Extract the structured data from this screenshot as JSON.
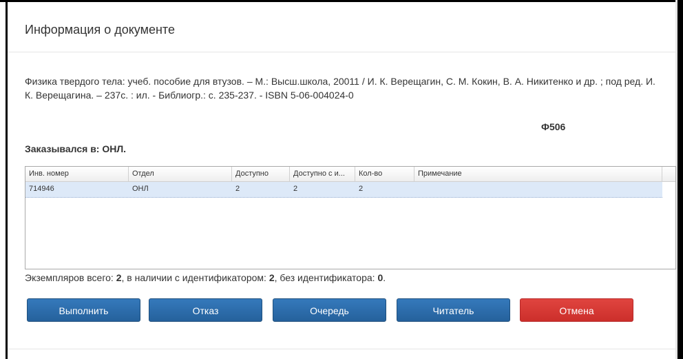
{
  "dialog": {
    "title": "Информация о документе",
    "description": "Физика твердого тела: учеб. пособие для втузов. – М.: Высш.школа, 20011 / И. К. Верещагин, С. М. Кокин, В. А. Никитенко и др. ; под ред. И. К. Верещагина. – 237с. : ил. - Библиогр.: с. 235-237. - ISBN 5-06-004024-0",
    "shelfmark": "Ф506",
    "ordered_in": "Заказывался в: ОНЛ."
  },
  "table": {
    "columns": [
      "Инв. номер",
      "Отдел",
      "Доступно",
      "Доступно с и...",
      "Кол-во",
      "Примечание"
    ],
    "rows": [
      {
        "inv": "714946",
        "dept": "ОНЛ",
        "available": "2",
        "available_id": "2",
        "qty": "2",
        "note": ""
      }
    ]
  },
  "summary": {
    "prefix": "Экземпляров всего: ",
    "total": "2",
    "mid1": ", в наличии с идентификатором: ",
    "with_id": "2",
    "mid2": ", без идентификатора: ",
    "without_id": "0",
    "suffix": "."
  },
  "buttons": {
    "execute": "Выполнить",
    "refuse": "Отказ",
    "queue": "Очередь",
    "reader": "Читатель",
    "cancel": "Отмена"
  },
  "colors": {
    "primary_button": "#2d6ead",
    "cancel_button": "#d9393a",
    "selected_row": "#dde9f8"
  }
}
